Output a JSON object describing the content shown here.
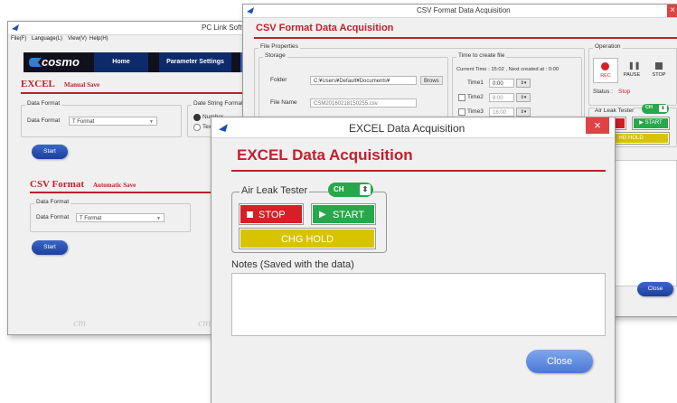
{
  "pc_link": {
    "title": "PC Link Softw",
    "menu": [
      "File(F)",
      "Language(L)",
      "View(V)",
      "Help(H)"
    ],
    "logo": "cosmo",
    "tabs": [
      "Home",
      "Parameter Settings"
    ],
    "excel_title": "EXCEL",
    "excel_mode": "Manual Save",
    "data_format_group": "Data Format",
    "data_format_label": "Data Format",
    "data_format_value": "T Format",
    "string_format_group": "Date String Format",
    "radio_number": "Number",
    "radio_text": "Tex",
    "start_label": "Start",
    "csv_title": "CSV Format",
    "csv_mode": "Automatic Save",
    "csv_data_format_group": "Data Format",
    "csv_data_format_label": "Data Format",
    "csv_data_format_value": "T Format",
    "csv_start_label": "Start",
    "watermark": "cm"
  },
  "csv_window": {
    "title": "CSV Format Data Acquisition",
    "heading": "CSV Format Data Acquisition",
    "file_properties": "File Properties",
    "storage": "Storage",
    "folder_label": "Folder",
    "folder_value": "C:¥Users¥Default¥Documents¥",
    "browse_label": "Brows",
    "file_name_label": "File Name",
    "file_name_value": "CSM20160218150255.csv",
    "time_group": "Time to create file",
    "current_time": "Current Time : 15:02 , Next created at : 0:00",
    "time1_label": "Time1",
    "time1_value": "0:00",
    "time2_label": "Time2",
    "time2_value": "8:00",
    "time3_label": "Time3",
    "time3_value": "16:00",
    "operation": "Operation",
    "rec_label": "REC",
    "pause_label": "PAUSE",
    "stop_label": "STOP",
    "status_label": "Status :",
    "status_value": "Stop",
    "air_leak_label": "Air Leak Tester",
    "ch_label": "CH",
    "start_small": "START",
    "chg_hold_small": "HG HOLD",
    "close_label": "Close"
  },
  "excel_window": {
    "title": "EXCEL Data Acquisition",
    "heading": "EXCEL Data Acquisition",
    "air_leak_label": "Air Leak Tester",
    "ch_label": "CH",
    "stop_label": "STOP",
    "start_label": "START",
    "chg_hold_label": "CHG HOLD",
    "notes_label": "Notes (Saved with the data)",
    "notes_value": "",
    "close_label": "Close"
  },
  "colors": {
    "accent_red": "#c0202c",
    "stop_red": "#d61f26",
    "start_green": "#27a84a",
    "chg_yellow": "#d7c300",
    "close_blue": "#3b66c8"
  }
}
